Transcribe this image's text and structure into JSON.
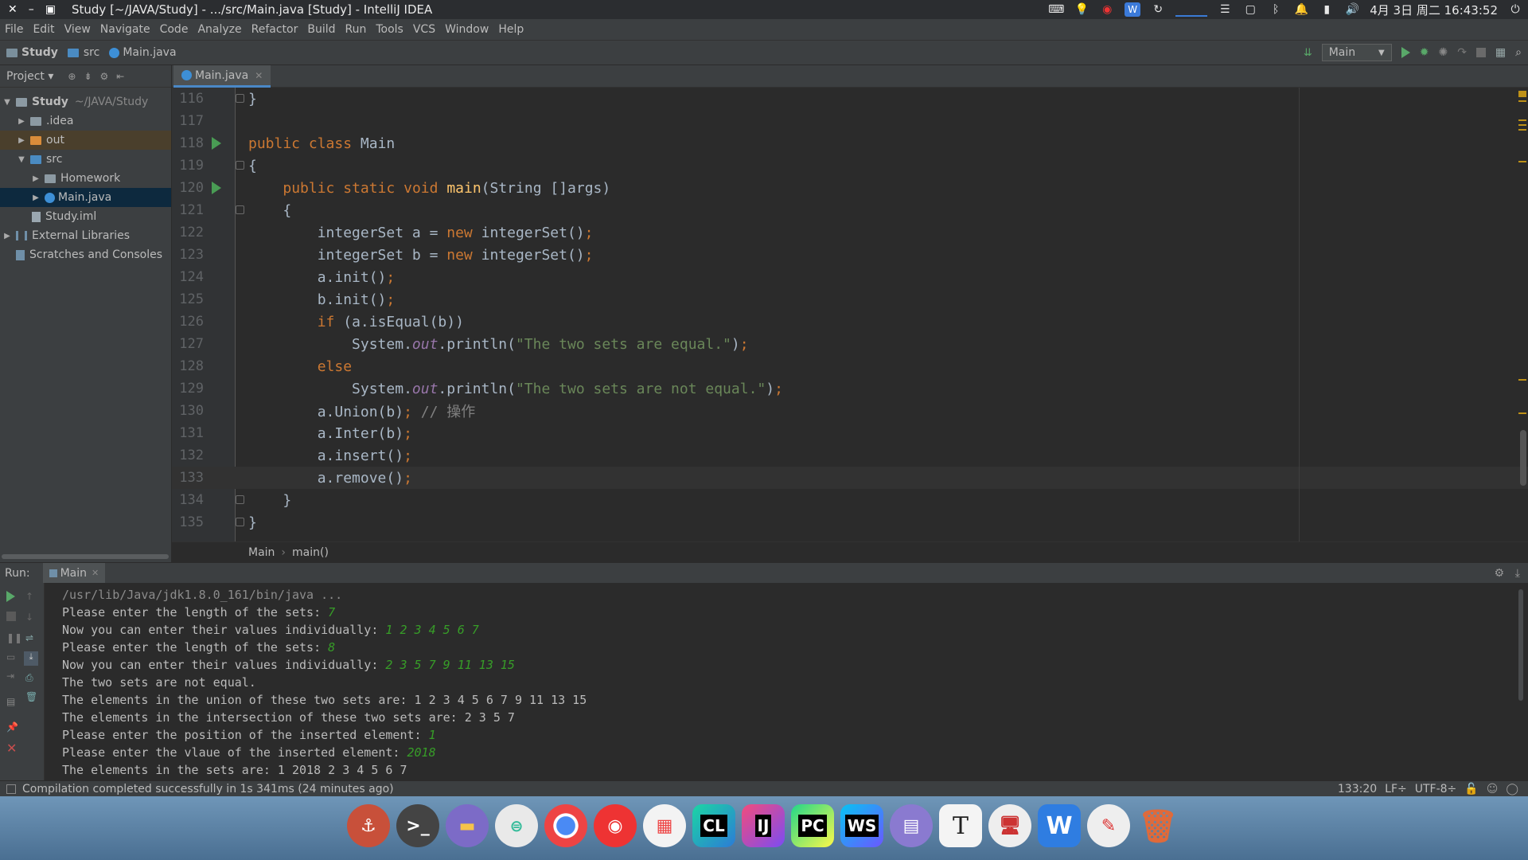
{
  "os_bar": {
    "title": "Study [~/JAVA/Study] - .../src/Main.java [Study] - IntelliJ IDEA",
    "clock": "4月 3日 周二 16:43:52"
  },
  "menu": [
    "File",
    "Edit",
    "View",
    "Navigate",
    "Code",
    "Analyze",
    "Refactor",
    "Build",
    "Run",
    "Tools",
    "VCS",
    "Window",
    "Help"
  ],
  "navbar": {
    "crumbs": [
      "Study",
      "src",
      "Main.java"
    ],
    "run_config": "Main"
  },
  "project": {
    "header": "Project",
    "root": {
      "name": "Study",
      "path": "~/JAVA/Study"
    },
    "items": [
      ".idea",
      "out",
      "src",
      "Homework",
      "Main.java",
      "Study.iml",
      "External Libraries",
      "Scratches and Consoles"
    ]
  },
  "editor": {
    "tab": "Main.java",
    "lines": [
      {
        "n": "116",
        "text": "}"
      },
      {
        "n": "117",
        "text": ""
      },
      {
        "n": "118",
        "text": "public class Main"
      },
      {
        "n": "119",
        "text": "{"
      },
      {
        "n": "120",
        "text": "public static void main(String []args)"
      },
      {
        "n": "121",
        "text": "{"
      },
      {
        "n": "122",
        "text": "integerSet a = new integerSet();"
      },
      {
        "n": "123",
        "text": "integerSet b = new integerSet();"
      },
      {
        "n": "124",
        "text": "a.init();"
      },
      {
        "n": "125",
        "text": "b.init();"
      },
      {
        "n": "126",
        "text": "if (a.isEqual(b))"
      },
      {
        "n": "127",
        "text": "System.out.println(\"The two sets are equal.\");"
      },
      {
        "n": "128",
        "text": "else"
      },
      {
        "n": "129",
        "text": "System.out.println(\"The two sets are not equal.\");"
      },
      {
        "n": "130",
        "text": "a.Union(b); // 操作"
      },
      {
        "n": "131",
        "text": "a.Inter(b);"
      },
      {
        "n": "132",
        "text": "a.insert();"
      },
      {
        "n": "133",
        "text": "a.remove();"
      },
      {
        "n": "134",
        "text": "}"
      },
      {
        "n": "135",
        "text": "}"
      }
    ],
    "breadcrumb": [
      "Main",
      "main()"
    ]
  },
  "run": {
    "label": "Run:",
    "tab": "Main",
    "console": [
      {
        "out": "/usr/lib/Java/jdk1.8.0_161/bin/java ...",
        "in": ""
      },
      {
        "out": "Please enter the length of the sets: ",
        "in": "7"
      },
      {
        "out": "Now you can enter their values individually: ",
        "in": "1 2 3 4 5 6 7"
      },
      {
        "out": "Please enter the length of the sets: ",
        "in": "8"
      },
      {
        "out": "Now you can enter their values individually: ",
        "in": "2 3 5 7 9 11 13 15"
      },
      {
        "out": "The two sets are not equal.",
        "in": ""
      },
      {
        "out": "The elements in the union of these two sets are: 1 2 3 4 5 6 7 9 11 13 15",
        "in": ""
      },
      {
        "out": "The elements in the intersection of these two sets are: 2 3 5 7",
        "in": ""
      },
      {
        "out": "Please enter the position of the inserted element: ",
        "in": "1"
      },
      {
        "out": "Please enter the vlaue of the inserted element: ",
        "in": "2018"
      },
      {
        "out": "The elements in the sets are: 1 2018 2 3 4 5 6 7",
        "in": ""
      }
    ]
  },
  "status": {
    "message": "Compilation completed successfully in 1s 341ms (24 minutes ago)",
    "position": "133:20",
    "line_sep": "LF÷",
    "encoding": "UTF-8÷"
  },
  "dock": [
    "CL",
    "IJ",
    "PC",
    "WS",
    "T"
  ]
}
